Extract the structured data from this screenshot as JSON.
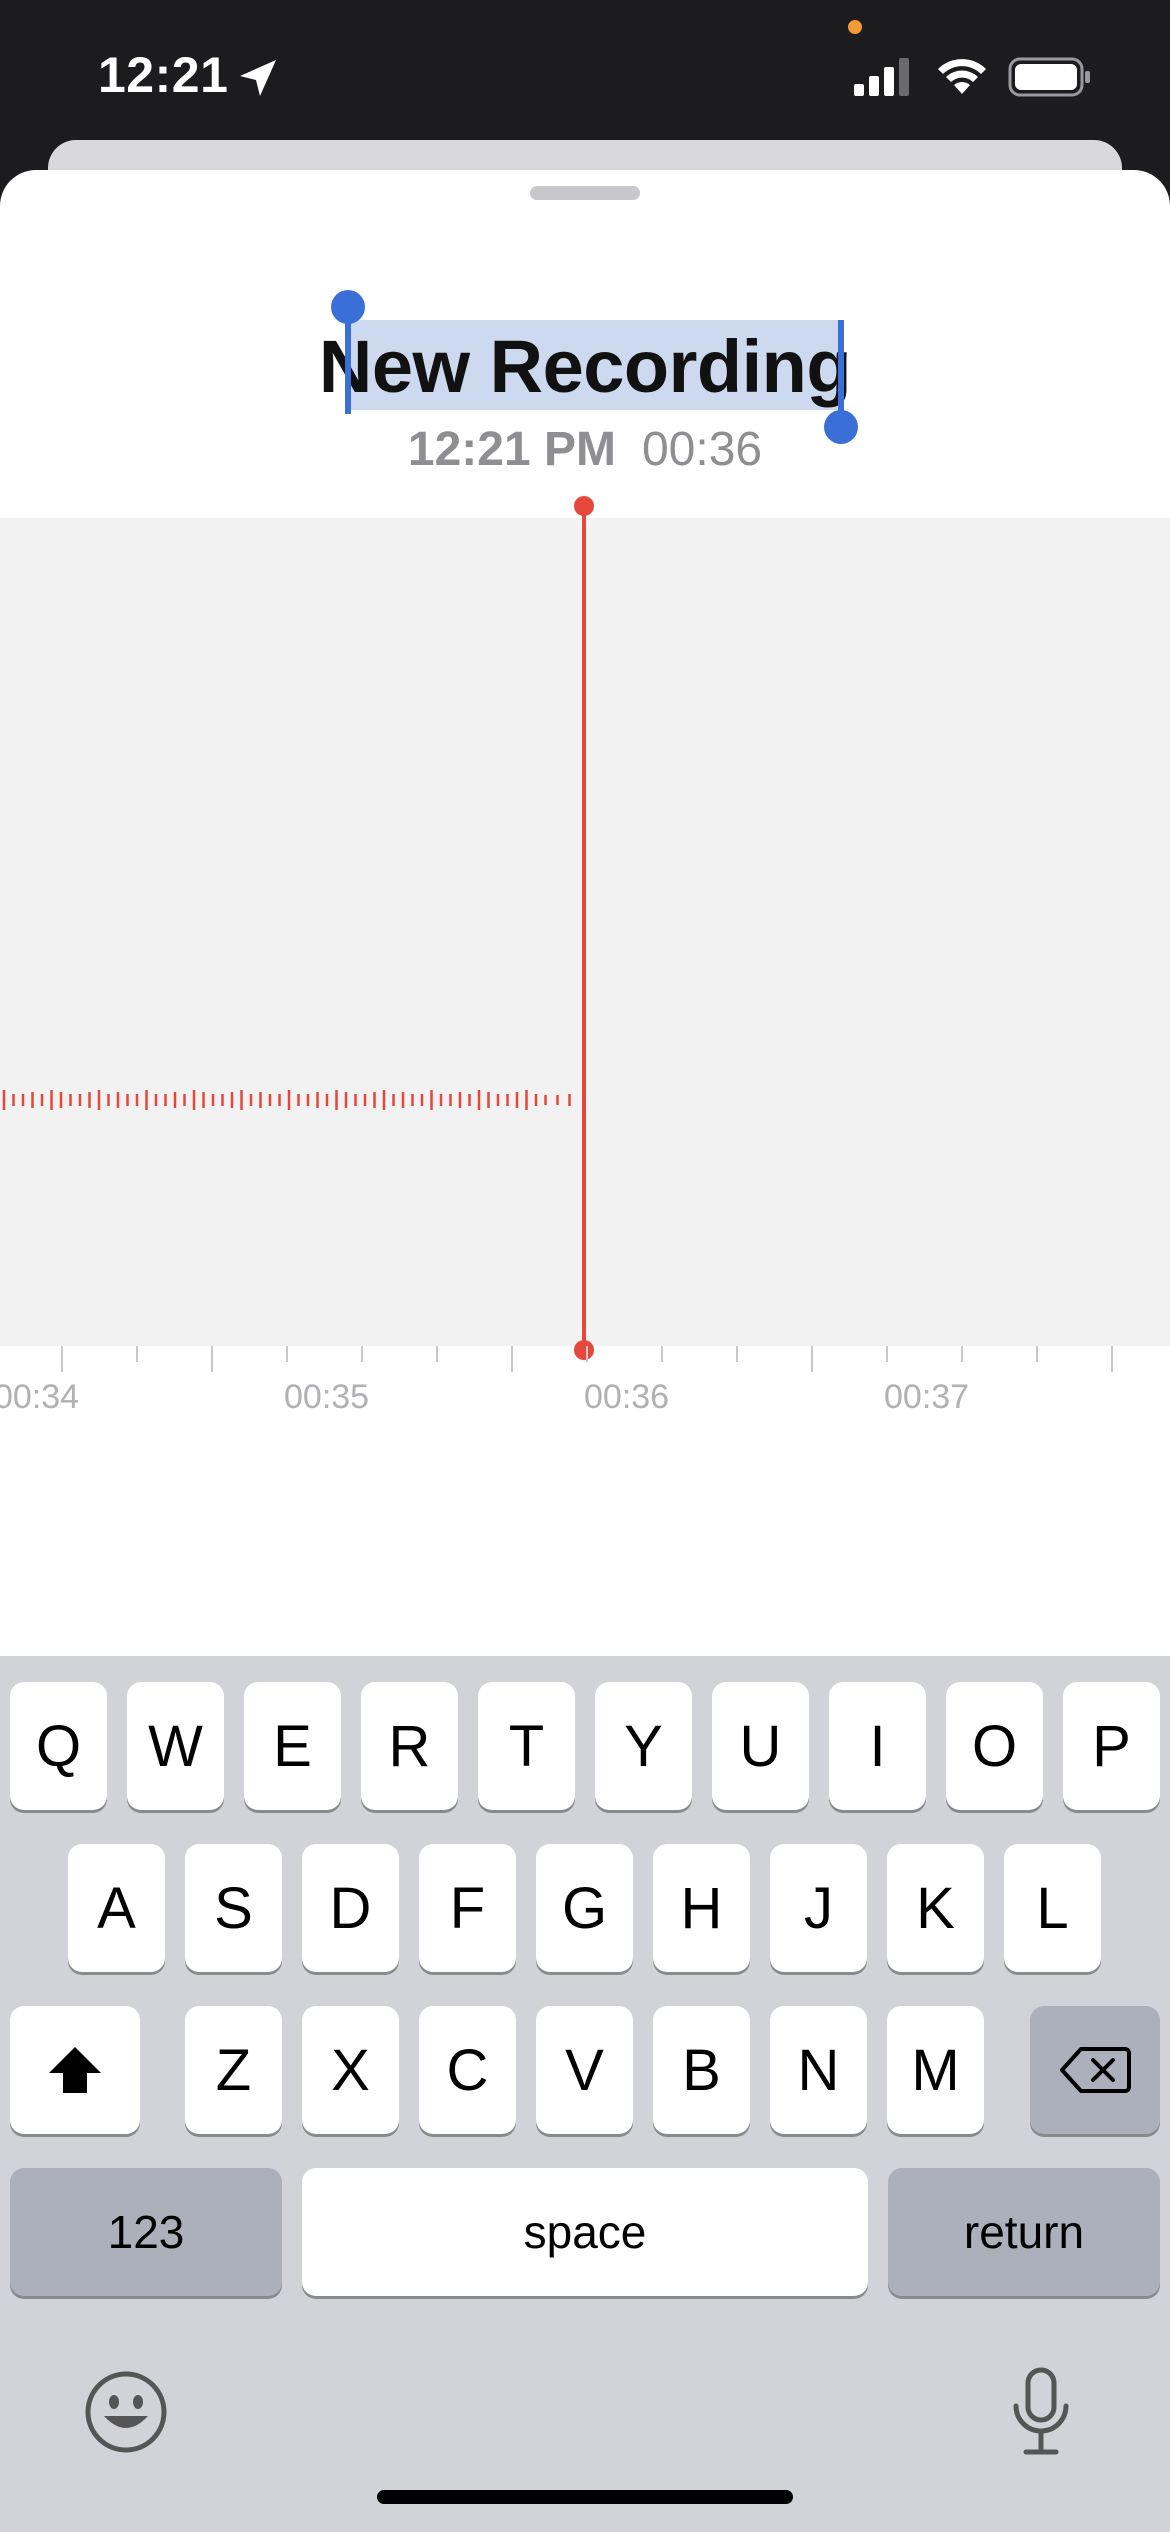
{
  "status_bar": {
    "time": "12:21"
  },
  "recording": {
    "title": "New Recording",
    "time": "12:21 PM",
    "duration": "00:36"
  },
  "timeline": {
    "labels": [
      "00:34",
      "00:35",
      "00:36",
      "00:37"
    ]
  },
  "keyboard": {
    "row1": [
      "Q",
      "W",
      "E",
      "R",
      "T",
      "Y",
      "U",
      "I",
      "O",
      "P"
    ],
    "row2": [
      "A",
      "S",
      "D",
      "F",
      "G",
      "H",
      "J",
      "K",
      "L"
    ],
    "row3": [
      "Z",
      "X",
      "C",
      "V",
      "B",
      "N",
      "M"
    ],
    "numbers_label": "123",
    "space_label": "space",
    "return_label": "return"
  },
  "colors": {
    "accent_red": "#e5473a",
    "selection_blue": "#3a6fd8"
  }
}
